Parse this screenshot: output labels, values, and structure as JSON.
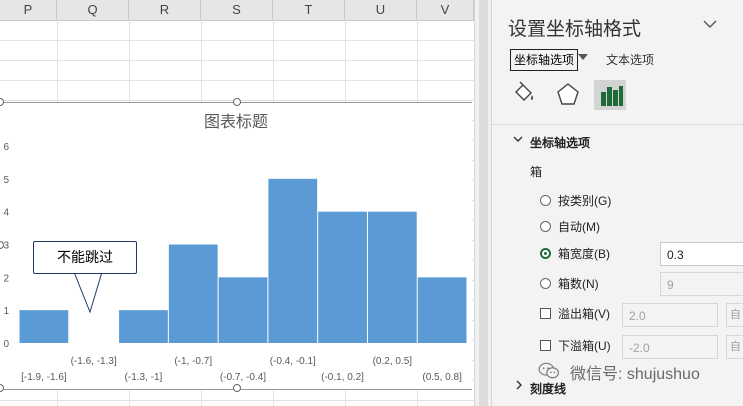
{
  "sheet": {
    "columns": [
      "P",
      "Q",
      "R",
      "S",
      "T",
      "U",
      "V"
    ]
  },
  "chart_data": {
    "type": "bar",
    "title": "图表标题",
    "categories": [
      "[-1.9, -1.6]",
      "(-1.6, -1.3]",
      "(-1.3, -1]",
      "(-1, -0.7]",
      "(-0.7, -0.4]",
      "(-0.4, -0.1]",
      "(-0.1, 0.2]",
      "(0.2, 0.5]",
      "(0.5, 0.8]"
    ],
    "values": [
      1,
      0,
      1,
      3,
      2,
      5,
      4,
      4,
      2
    ],
    "yticks": [
      "0",
      "1",
      "2",
      "3",
      "4",
      "5",
      "6"
    ],
    "ylim": [
      0,
      6
    ],
    "xlabel": "",
    "ylabel": "",
    "grid": false,
    "bar_color": "#5b9bd5"
  },
  "callout": {
    "text": "不能跳过"
  },
  "panel": {
    "title": "设置坐标轴格式",
    "tab_axis": "坐标轴选项",
    "tab_text": "文本选项",
    "section_title": "坐标轴选项",
    "bins_label": "箱",
    "options": {
      "by_category": "按类别(G)",
      "auto": "自动(M)",
      "bin_width": "箱宽度(B)",
      "bin_count": "箱数(N)",
      "overflow": "溢出箱(V)",
      "underflow": "下溢箱(U)"
    },
    "bin_width_value": "0.3",
    "bin_count_value": "9",
    "overflow_value": "2.0",
    "underflow_value": "-2.0",
    "auto_btn": "自",
    "tick_section": "刻度线",
    "accent_color": "#1e6a39"
  },
  "watermark": {
    "text": "微信号: shujushuo"
  }
}
